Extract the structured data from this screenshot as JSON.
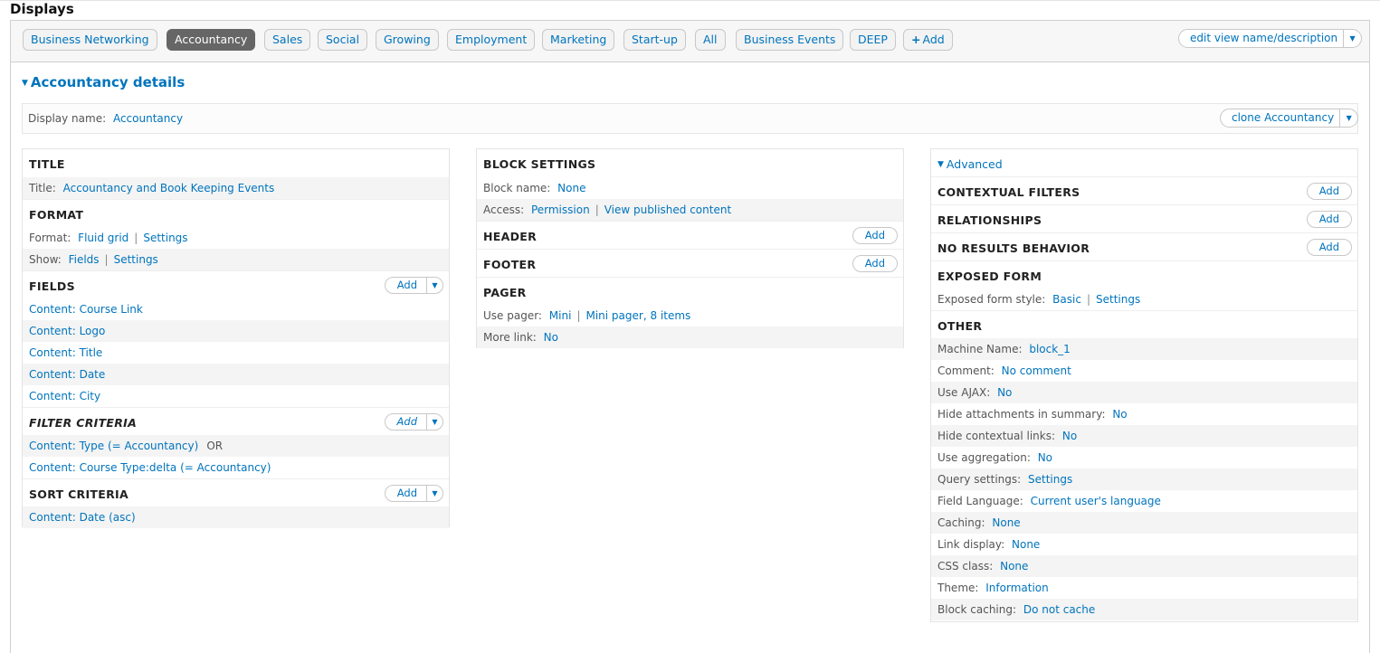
{
  "page_title": "Displays",
  "tabs": [
    "Business Networking",
    "Accountancy",
    "Sales",
    "Social",
    "Growing",
    "Employment",
    "Marketing",
    "Start-up",
    "All",
    "Business Events",
    "DEEP"
  ],
  "active_tab": "Accountancy",
  "add_tab_label": "Add",
  "edit_view_label": "edit view name/description",
  "details_title": "Accountancy details",
  "display_name": {
    "label": "Display name:",
    "value": "Accountancy"
  },
  "clone_label": "clone Accountancy",
  "add_label": "Add",
  "left": {
    "title_section": {
      "heading": "TITLE",
      "label": "Title:",
      "value": "Accountancy and Book Keeping Events"
    },
    "format_section": {
      "heading": "FORMAT",
      "format_label": "Format:",
      "format_value": "Fluid grid",
      "format_settings": "Settings",
      "show_label": "Show:",
      "show_value": "Fields",
      "show_settings": "Settings"
    },
    "fields_section": {
      "heading": "FIELDS",
      "items": [
        "Content: Course Link",
        "Content: Logo",
        "Content: Title",
        "Content: Date",
        "Content: City"
      ]
    },
    "filter_section": {
      "heading": "FILTER CRITERIA",
      "item1": "Content: Type (= Accountancy)",
      "or_label": "OR",
      "item2": "Content: Course Type:delta (= Accountancy)"
    },
    "sort_section": {
      "heading": "SORT CRITERIA",
      "item": "Content: Date (asc)"
    }
  },
  "middle": {
    "block_settings": {
      "heading": "BLOCK SETTINGS",
      "name_label": "Block name:",
      "name_value": "None",
      "access_label": "Access:",
      "access_value": "Permission",
      "access_extra": "View published content"
    },
    "header_heading": "HEADER",
    "footer_heading": "FOOTER",
    "pager": {
      "heading": "PAGER",
      "use_label": "Use pager:",
      "use_value": "Mini",
      "use_extra": "Mini pager, 8 items",
      "more_label": "More link:",
      "more_value": "No"
    }
  },
  "right": {
    "advanced_label": "Advanced",
    "contextual_heading": "CONTEXTUAL FILTERS",
    "relationships_heading": "RELATIONSHIPS",
    "no_results_heading": "NO RESULTS BEHAVIOR",
    "exposed": {
      "heading": "EXPOSED FORM",
      "label": "Exposed form style:",
      "value": "Basic",
      "settings": "Settings"
    },
    "other": {
      "heading": "OTHER",
      "rows": [
        {
          "label": "Machine Name:",
          "value": "block_1"
        },
        {
          "label": "Comment:",
          "value": "No comment"
        },
        {
          "label": "Use AJAX:",
          "value": "No"
        },
        {
          "label": "Hide attachments in summary:",
          "value": "No"
        },
        {
          "label": "Hide contextual links:",
          "value": "No"
        },
        {
          "label": "Use aggregation:",
          "value": "No"
        },
        {
          "label": "Query settings:",
          "value": "Settings"
        },
        {
          "label": "Field Language:",
          "value": "Current user's language"
        },
        {
          "label": "Caching:",
          "value": "None"
        },
        {
          "label": "Link display:",
          "value": "None"
        },
        {
          "label": "CSS class:",
          "value": "None"
        },
        {
          "label": "Theme:",
          "value": "Information"
        },
        {
          "label": "Block caching:",
          "value": "Do not cache"
        }
      ]
    }
  }
}
